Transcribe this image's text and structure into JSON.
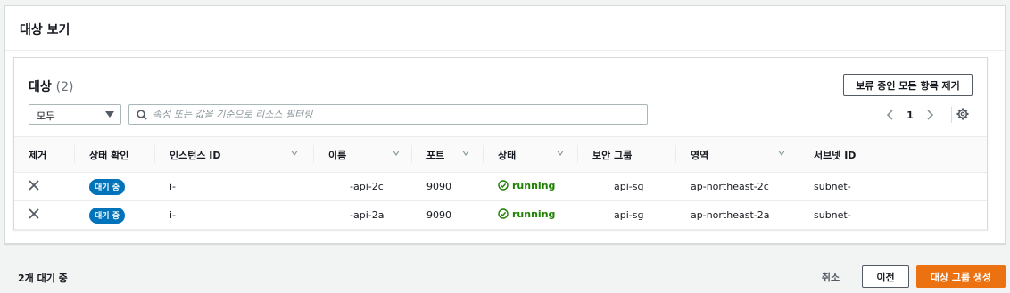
{
  "panel": {
    "title": "대상 보기"
  },
  "targets": {
    "title": "대상",
    "count": "(2)",
    "remove_all_label": "보류 중인 모든 항목 제거",
    "filter": {
      "selected": "모두"
    },
    "search": {
      "placeholder": "속성 또는 값을 기준으로 리소스 필터링"
    },
    "pagination": {
      "current_page": "1"
    },
    "icons": {
      "search": "search-icon",
      "prev": "chevron-left-icon",
      "next": "chevron-right-icon",
      "settings": "gear-icon",
      "remove": "close-icon",
      "status": "check-circle-icon"
    },
    "columns": [
      "제거",
      "상태 확인",
      "인스턴스 ID",
      "이름",
      "포트",
      "상태",
      "보안 그룹",
      "영역",
      "서브넷 ID"
    ],
    "rows": [
      {
        "health": "대기 중",
        "instance_id": "i-",
        "name": "-api-2c",
        "port": "9090",
        "status": "running",
        "security_group": "api-sg",
        "zone": "ap-northeast-2c",
        "subnet": "subnet-"
      },
      {
        "health": "대기 중",
        "instance_id": "i-",
        "name": "-api-2a",
        "port": "9090",
        "status": "running",
        "security_group": "api-sg",
        "zone": "ap-northeast-2a",
        "subnet": "subnet-"
      }
    ]
  },
  "footer": {
    "pending_text": "2개 대기 중",
    "cancel_label": "취소",
    "prev_label": "이전",
    "create_label": "대상 그룹 생성"
  },
  "colors": {
    "primary_button": "#ec7211",
    "badge": "#0073bb",
    "running": "#1d8102"
  }
}
